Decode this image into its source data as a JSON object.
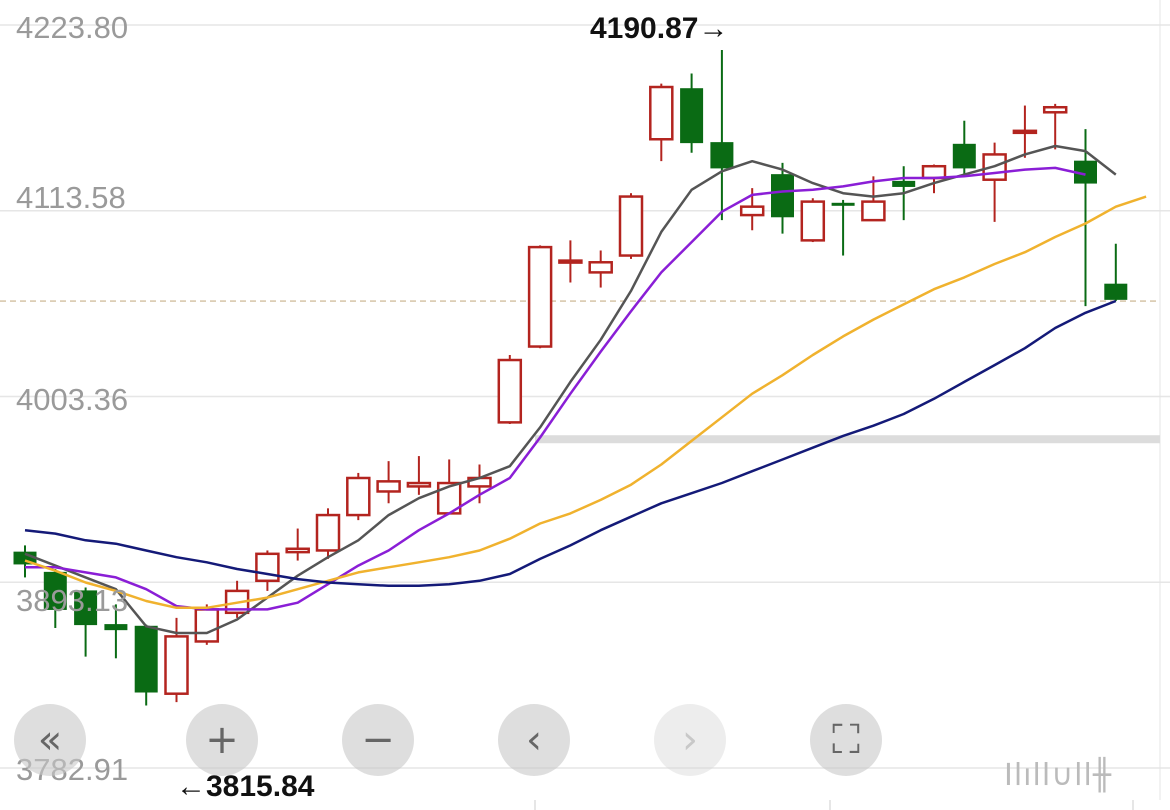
{
  "chart_data": {
    "type": "candlestick",
    "y_axis_labels": [
      "4223.80",
      "4113.58",
      "4003.36",
      "3893.13",
      "3782.91"
    ],
    "ylim": [
      3782.91,
      4223.8
    ],
    "annotations": {
      "high_label": "4190.87→",
      "low_label": "←3815.84"
    },
    "dashed_price_line": 4060,
    "colors": {
      "up": "#b3241f",
      "down": "#0a6b14",
      "ma1": "#555555",
      "ma2": "#8a1ed6",
      "ma3": "#f0b22e",
      "ma4": "#141a78",
      "grid": "#e6e6e6",
      "dashed": "#c8b08a"
    },
    "candles": [
      {
        "o": 3911,
        "c": 3904,
        "h": 3915,
        "l": 3896
      },
      {
        "o": 3899,
        "c": 3877,
        "h": 3901,
        "l": 3866
      },
      {
        "o": 3888,
        "c": 3868,
        "h": 3890,
        "l": 3849
      },
      {
        "o": 3868,
        "c": 3865,
        "h": 3880,
        "l": 3848
      },
      {
        "o": 3867,
        "c": 3828,
        "h": 3868,
        "l": 3820
      },
      {
        "o": 3827,
        "c": 3861,
        "h": 3872,
        "l": 3822
      },
      {
        "o": 3858,
        "c": 3877,
        "h": 3880,
        "l": 3856
      },
      {
        "o": 3875,
        "c": 3888,
        "h": 3894,
        "l": 3872
      },
      {
        "o": 3894,
        "c": 3910,
        "h": 3912,
        "l": 3888
      },
      {
        "o": 3911,
        "c": 3913,
        "h": 3925,
        "l": 3906
      },
      {
        "o": 3912,
        "c": 3933,
        "h": 3937,
        "l": 3907
      },
      {
        "o": 3933,
        "c": 3955,
        "h": 3958,
        "l": 3930
      },
      {
        "o": 3947,
        "c": 3953,
        "h": 3965,
        "l": 3940
      },
      {
        "o": 3950,
        "c": 3952,
        "h": 3968,
        "l": 3945
      },
      {
        "o": 3934,
        "c": 3952,
        "h": 3966,
        "l": 3934
      },
      {
        "o": 3950,
        "c": 3955,
        "h": 3963,
        "l": 3940
      },
      {
        "o": 3988,
        "c": 4025,
        "h": 4028,
        "l": 3987
      },
      {
        "o": 4033,
        "c": 4092,
        "h": 4093,
        "l": 4032
      },
      {
        "o": 4083,
        "c": 4084,
        "h": 4096,
        "l": 4071
      },
      {
        "o": 4077,
        "c": 4083,
        "h": 4090,
        "l": 4068
      },
      {
        "o": 4087,
        "c": 4122,
        "h": 4124,
        "l": 4085
      },
      {
        "o": 4156,
        "c": 4187,
        "h": 4189,
        "l": 4143
      },
      {
        "o": 4186,
        "c": 4154,
        "h": 4195,
        "l": 4148
      },
      {
        "o": 4154,
        "c": 4139,
        "h": 4209,
        "l": 4108
      },
      {
        "o": 4111,
        "c": 4116,
        "h": 4127,
        "l": 4102
      },
      {
        "o": 4135,
        "c": 4110,
        "h": 4142,
        "l": 4100
      },
      {
        "o": 4096,
        "c": 4119,
        "h": 4121,
        "l": 4095
      },
      {
        "o": 4118,
        "c": 4117,
        "h": 4120,
        "l": 4087
      },
      {
        "o": 4108,
        "c": 4119,
        "h": 4134,
        "l": 4108
      },
      {
        "o": 4131,
        "c": 4128,
        "h": 4140,
        "l": 4108
      },
      {
        "o": 4133,
        "c": 4140,
        "h": 4141,
        "l": 4124
      },
      {
        "o": 4153,
        "c": 4139,
        "h": 4167,
        "l": 4135
      },
      {
        "o": 4132,
        "c": 4147,
        "h": 4154,
        "l": 4107
      },
      {
        "o": 4160,
        "c": 4161,
        "h": 4176,
        "l": 4145
      },
      {
        "o": 4172,
        "c": 4175,
        "h": 4177,
        "l": 4150
      },
      {
        "o": 4143,
        "c": 4130,
        "h": 4162,
        "l": 4057
      },
      {
        "o": 4070,
        "c": 4061,
        "h": 4094,
        "l": 4060
      }
    ],
    "ma_lines": [
      {
        "color_key": "ma1",
        "values": [
          3910,
          3903,
          3896,
          3889,
          3867,
          3863,
          3863,
          3871,
          3884,
          3897,
          3908,
          3918,
          3933,
          3943,
          3950,
          3955,
          3962,
          3985,
          4012,
          4037,
          4066,
          4101,
          4126,
          4137,
          4143,
          4138,
          4130,
          4124,
          4122,
          4124,
          4130,
          4135,
          4140,
          4147,
          4152,
          4149,
          4135
        ]
      },
      {
        "color_key": "ma2",
        "values": [
          3902,
          3902,
          3899,
          3896,
          3889,
          3879,
          3877,
          3877,
          3877,
          3881,
          3892,
          3903,
          3912,
          3924,
          3934,
          3945,
          3955,
          3979,
          4005,
          4030,
          4054,
          4077,
          4095,
          4113,
          4123,
          4125,
          4126,
          4128,
          4131,
          4133,
          4133,
          4134,
          4136,
          4138,
          4139,
          4135
        ]
      },
      {
        "color_key": "ma3",
        "values": [
          3906,
          3900,
          3893,
          3888,
          3882,
          3878,
          3878,
          3881,
          3884,
          3889,
          3894,
          3899,
          3902,
          3905,
          3908,
          3912,
          3919,
          3928,
          3934,
          3942,
          3951,
          3963,
          3977,
          3991,
          4005,
          4016,
          4028,
          4039,
          4049,
          4058,
          4067,
          4074,
          4082,
          4089,
          4098,
          4106,
          4116,
          4122
        ]
      },
      {
        "color_key": "ma4",
        "values": [
          3924,
          3922,
          3918,
          3916,
          3912,
          3908,
          3905,
          3901,
          3898,
          3895,
          3893,
          3892,
          3891,
          3891,
          3892,
          3894,
          3898,
          3907,
          3915,
          3924,
          3932,
          3940,
          3946,
          3952,
          3959,
          3966,
          3973,
          3980,
          3986,
          3993,
          4002,
          4012,
          4022,
          4032,
          4044,
          4053,
          4060
        ]
      }
    ]
  },
  "controls": {
    "zoom_out_all": "«",
    "zoom_in": "+",
    "zoom_out": "−",
    "prev": "‹",
    "next": "›",
    "fullscreen": "⛶"
  },
  "brand_text": "Ilıll∪ll╫"
}
